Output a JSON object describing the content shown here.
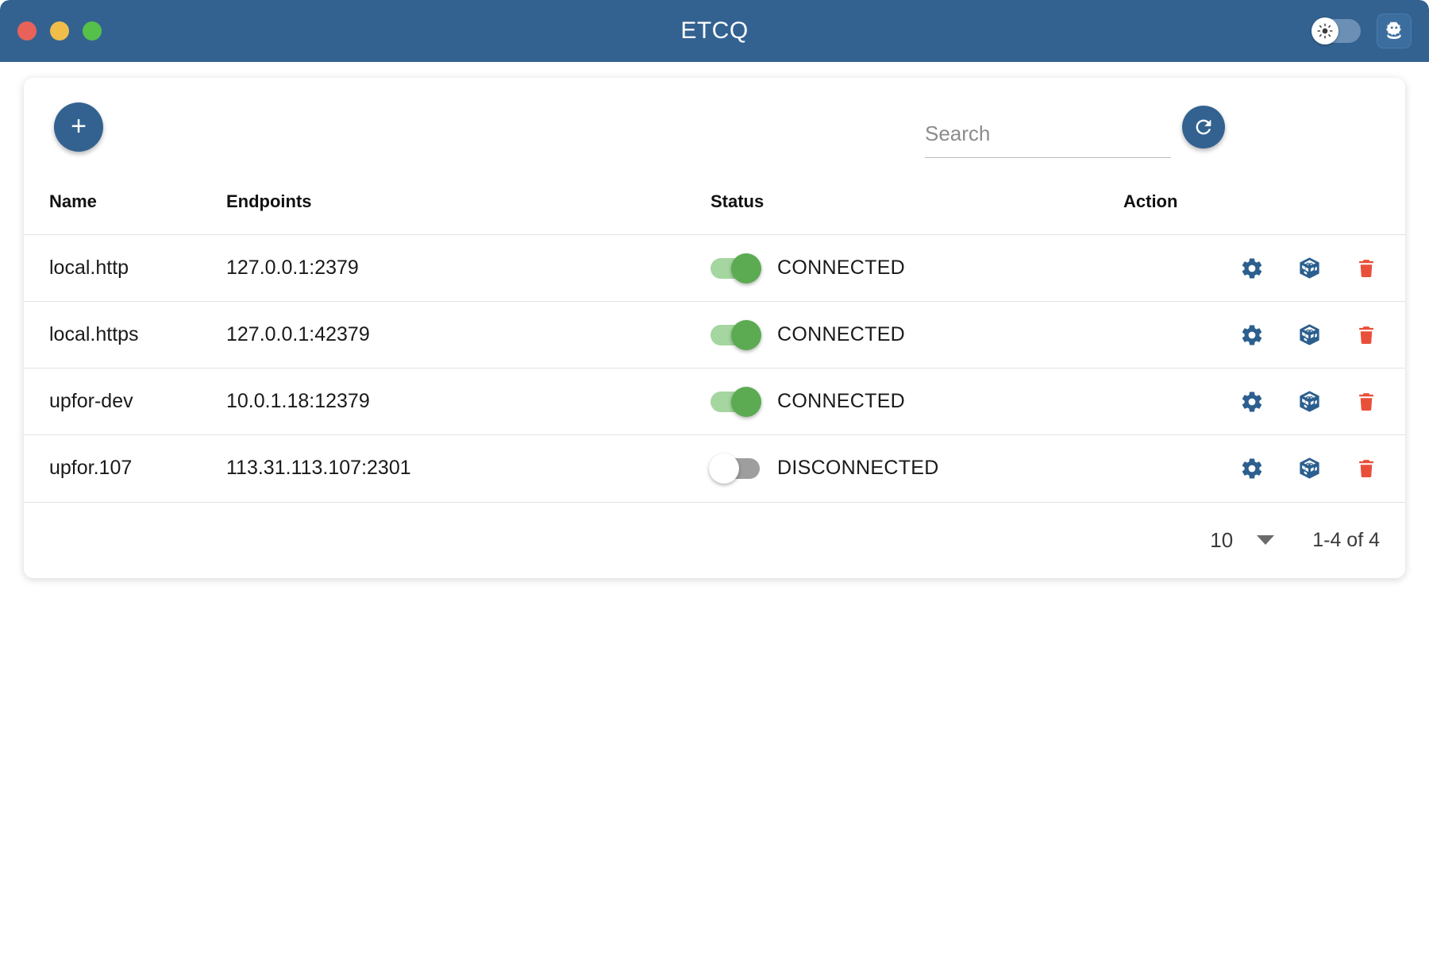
{
  "window": {
    "title": "ETCQ",
    "traffic_lights": [
      {
        "name": "close",
        "color": "#e8625a"
      },
      {
        "name": "minimize",
        "color": "#f0bd4a"
      },
      {
        "name": "maximize",
        "color": "#55c14a"
      }
    ],
    "titlebar_color": "#336291",
    "theme_toggle": {
      "icon": "sun-icon",
      "state": "off",
      "track_color": "#6b8fb5"
    },
    "mascot_button": {
      "icon": "robot-icon"
    }
  },
  "toolbar": {
    "add_label": "+",
    "add_icon": "plus-icon",
    "refresh_icon": "refresh-icon",
    "search": {
      "placeholder": "Search",
      "value": ""
    }
  },
  "table": {
    "columns": [
      {
        "key": "name",
        "label": "Name"
      },
      {
        "key": "endpoints",
        "label": "Endpoints"
      },
      {
        "key": "status",
        "label": "Status"
      },
      {
        "key": "action",
        "label": "Action"
      }
    ],
    "rows": [
      {
        "name": "local.http",
        "endpoints": "127.0.0.1:2379",
        "status_label": "CONNECTED",
        "status_on": true
      },
      {
        "name": "local.https",
        "endpoints": "127.0.0.1:42379",
        "status_label": "CONNECTED",
        "status_on": true
      },
      {
        "name": "upfor-dev",
        "endpoints": "10.0.1.18:12379",
        "status_label": "CONNECTED",
        "status_on": true
      },
      {
        "name": "upfor.107",
        "endpoints": "113.31.113.107:2301",
        "status_label": "DISCONNECTED",
        "status_on": false
      }
    ],
    "row_actions": [
      {
        "name": "settings",
        "icon": "gear-icon",
        "color": "#2b5f8e"
      },
      {
        "name": "cluster",
        "icon": "cube-icon",
        "color": "#2b5f8e"
      },
      {
        "name": "delete",
        "icon": "trash-icon",
        "color": "#e8503a"
      }
    ]
  },
  "pagination": {
    "page_size": "10",
    "range_label": "1-4 of 4"
  },
  "colors": {
    "accent": "#336291",
    "connected": "#5cab52",
    "disconnected": "#9e9e9e",
    "danger": "#e8503a"
  }
}
